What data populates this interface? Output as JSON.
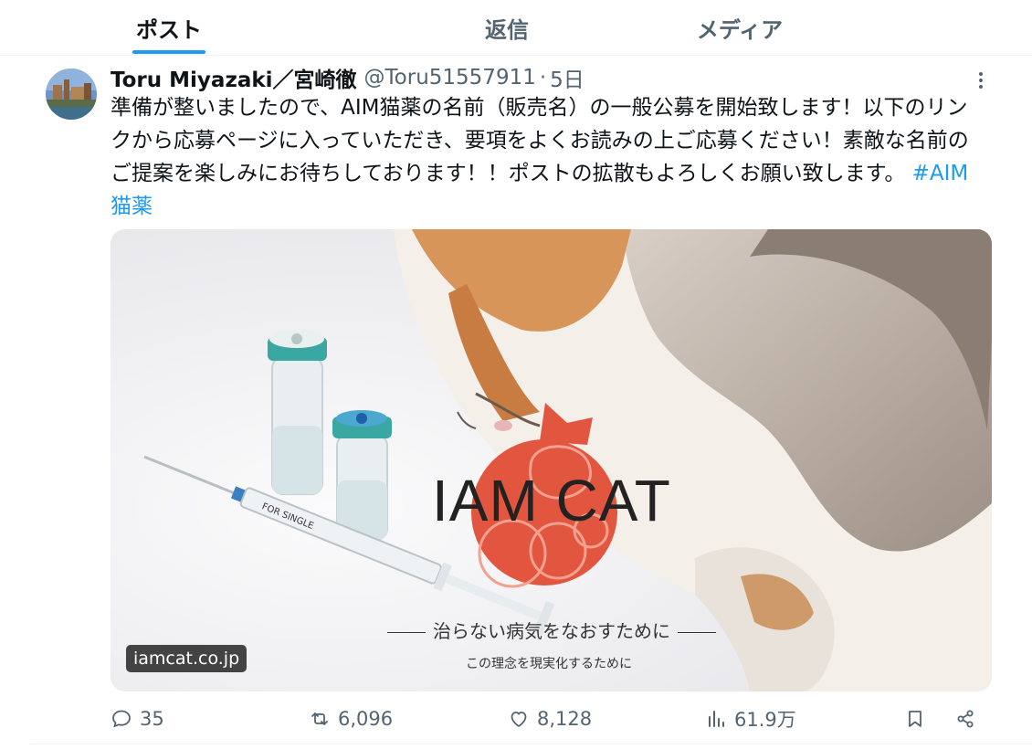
{
  "tabs": [
    {
      "label": "ポスト",
      "active": true
    },
    {
      "label": "返信",
      "active": false
    },
    {
      "label": "メディア",
      "active": false
    }
  ],
  "tweet": {
    "author_name": "Toru Miyazaki／宮崎徹",
    "handle": "@Toru51557911",
    "separator": "·",
    "time": "5日",
    "text": "準備が整いましたので、AIM猫薬の名前（販売名）の一般公募を開始致します！以下のリンクから応募ページに入っていただき、要項をよくお読みの上ご応募ください！素敵な名前のご提案を楽しみにお待ちしております！！ポストの拡散もよろしくお願い致します。",
    "hashtag": "#AIM猫薬"
  },
  "card": {
    "domain": "iamcat.co.jp",
    "logo_text": "IAM CAT",
    "tagline": "治らない病気をなおすために",
    "subtagline": "この理念を現実化するために",
    "syringe_label": "FOR SINGLE"
  },
  "actions": {
    "replies": "35",
    "reposts": "6,096",
    "likes": "8,128",
    "views": "61.9万"
  },
  "colors": {
    "accent": "#1d9bf0",
    "logo_red": "#e2553f",
    "muted": "#536471"
  }
}
